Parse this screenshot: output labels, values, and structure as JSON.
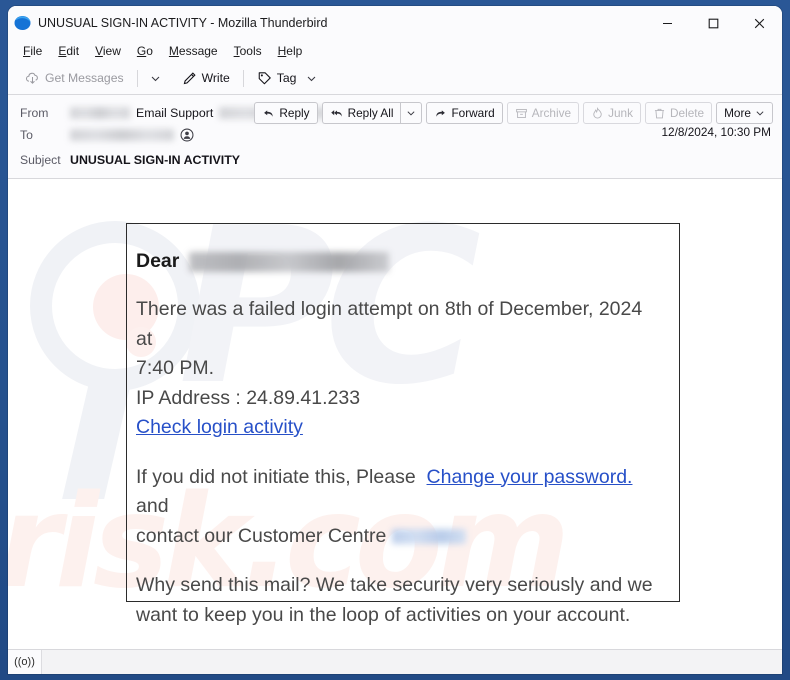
{
  "window": {
    "title": "UNUSUAL SIGN-IN ACTIVITY - Mozilla Thunderbird",
    "logo_icon": "thunderbird-logo",
    "controls": {
      "minimize": "minimize-icon",
      "maximize": "maximize-icon",
      "close": "close-icon"
    }
  },
  "menubar": {
    "items": [
      {
        "label": "File",
        "accel": "F"
      },
      {
        "label": "Edit",
        "accel": "E"
      },
      {
        "label": "View",
        "accel": "V"
      },
      {
        "label": "Go",
        "accel": "G"
      },
      {
        "label": "Message",
        "accel": "M"
      },
      {
        "label": "Tools",
        "accel": "T"
      },
      {
        "label": "Help",
        "accel": "H"
      }
    ]
  },
  "toolbar": {
    "get_messages": "Get Messages",
    "get_messages_icon": "download-cloud-icon",
    "get_messages_caret_icon": "chevron-down-icon",
    "write": "Write",
    "write_icon": "pencil-icon",
    "tag": "Tag",
    "tag_icon": "tag-icon",
    "tag_caret_icon": "chevron-down-icon"
  },
  "message_header": {
    "from_label": "From",
    "from_name": "Email Support",
    "from_redacted_before": true,
    "from_redacted_after": true,
    "from_avatar_icon": "contact-avatar-icon",
    "to_label": "To",
    "to_redacted": true,
    "to_avatar_icon": "contact-avatar-icon",
    "subject_label": "Subject",
    "subject": "UNUSUAL SIGN-IN ACTIVITY",
    "timestamp": "12/8/2024, 10:30 PM",
    "actions": [
      {
        "label": "Reply",
        "icon": "reply-icon",
        "disabled": false
      },
      {
        "label": "Reply All",
        "icon": "reply-all-icon",
        "disabled": false,
        "caret": "chevron-down-icon"
      },
      {
        "label": "Forward",
        "icon": "forward-icon",
        "disabled": false
      },
      {
        "label": "Archive",
        "icon": "archive-box-icon",
        "disabled": true
      },
      {
        "label": "Junk",
        "icon": "junk-fire-icon",
        "disabled": true
      },
      {
        "label": "Delete",
        "icon": "trash-icon",
        "disabled": true
      },
      {
        "label": "More",
        "icon": "chevron-down-icon",
        "disabled": false
      }
    ]
  },
  "email_body": {
    "greeting_prefix": "Dear",
    "greeting_name_redacted": true,
    "paragraph_1_line_1": "There was a failed login attempt on 8th of December, 2024 at",
    "paragraph_1_line_2": "7:40 PM.",
    "ip_line": "IP Address : 24.89.41.233",
    "link_check_activity": "Check login activity",
    "paragraph_2_prefix": "If you did not initiate this, Please",
    "link_change_password": "Change your password.",
    "paragraph_2_suffix": "and",
    "paragraph_2_line_2": "contact our Customer Centre",
    "customer_centre_redacted": true,
    "paragraph_3_line_1": "Why send this mail? We take security very seriously and we",
    "paragraph_3_line_2": "want to keep you in the loop of activities on your account."
  },
  "statusbar": {
    "connection_icon": "((o))"
  },
  "colors": {
    "window_frame": "#2a5796",
    "toolbar_bg": "#fbfbfd",
    "link": "#2750c8",
    "body_text": "#494949",
    "border": "#2b2b2b"
  },
  "watermark": {
    "brand": "PC",
    "brand_sub": "risk.com",
    "lens_icon": "magnifier-icon"
  }
}
